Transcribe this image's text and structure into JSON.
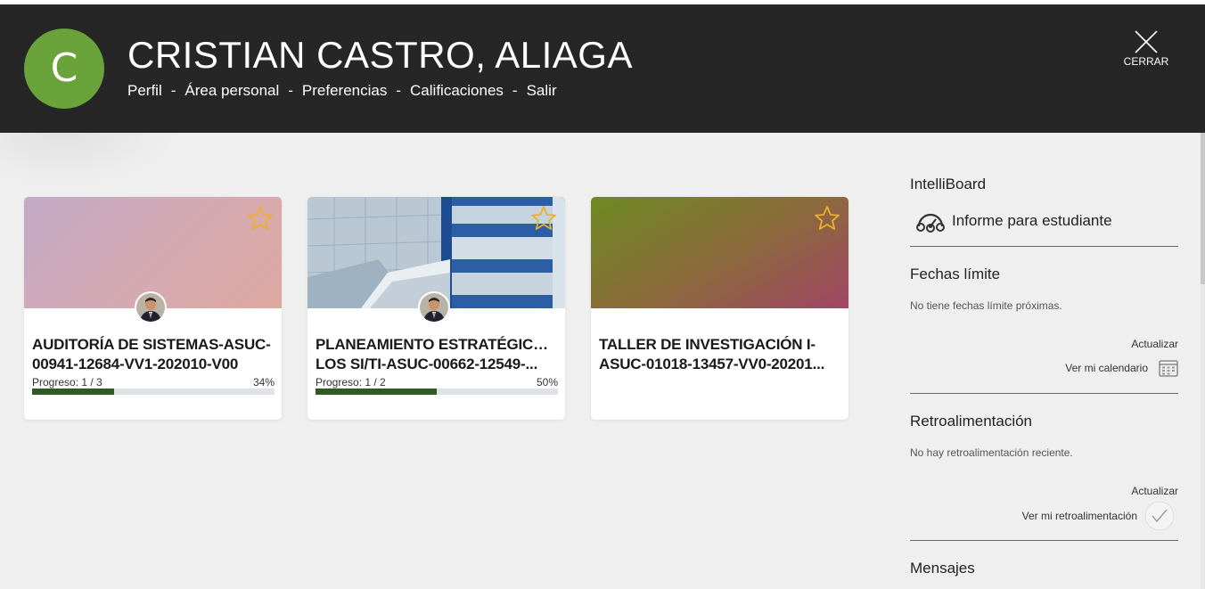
{
  "header": {
    "avatar_initial": "C",
    "user_name": "CRISTIAN CASTRO, ALIAGA",
    "nav": [
      {
        "label": "Perfil"
      },
      {
        "label": "Área personal"
      },
      {
        "label": "Preferencias"
      },
      {
        "label": "Calificaciones"
      },
      {
        "label": "Salir"
      }
    ],
    "nav_separator": "-",
    "close_label": "CERRAR"
  },
  "courses": [
    {
      "title_line1": "AUDITORÍA DE SISTEMAS-ASUC-",
      "title_line2": "00941-12684-VV1-202010-V00",
      "progress_label": "Progreso: 1 / 3",
      "progress_pct": "34%",
      "progress_value": 34,
      "image": "gradient-lilac-pink",
      "starred": false
    },
    {
      "title_line1": "PLANEAMIENTO ESTRATÉGICO DE",
      "title_line2": "LOS SI/TI-ASUC-00662-12549-...",
      "progress_label": "Progreso: 1 / 2",
      "progress_pct": "50%",
      "progress_value": 50,
      "image": "building-photo",
      "starred": false
    },
    {
      "title_line1": "TALLER DE INVESTIGACIÓN I-",
      "title_line2": "ASUC-01018-13457-VV0-20201...",
      "image": "gradient-olive-magenta",
      "starred": false
    }
  ],
  "sidebar": {
    "intelliboard": {
      "title": "IntelliBoard",
      "link": "Informe para estudiante"
    },
    "deadlines": {
      "title": "Fechas límite",
      "empty": "No tiene fechas límite próximas.",
      "refresh": "Actualizar",
      "calendar": "Ver mi calendario"
    },
    "feedback": {
      "title": "Retroalimentación",
      "empty": "No hay retroalimentación reciente.",
      "refresh": "Actualizar",
      "view": "Ver mi retroalimentación"
    },
    "messages": {
      "title": "Mensajes"
    }
  },
  "colors": {
    "header_bg": "#262626",
    "avatar_bg": "#6aa33a",
    "progress_fill": "#2f5a23",
    "star": "#e9b227"
  }
}
